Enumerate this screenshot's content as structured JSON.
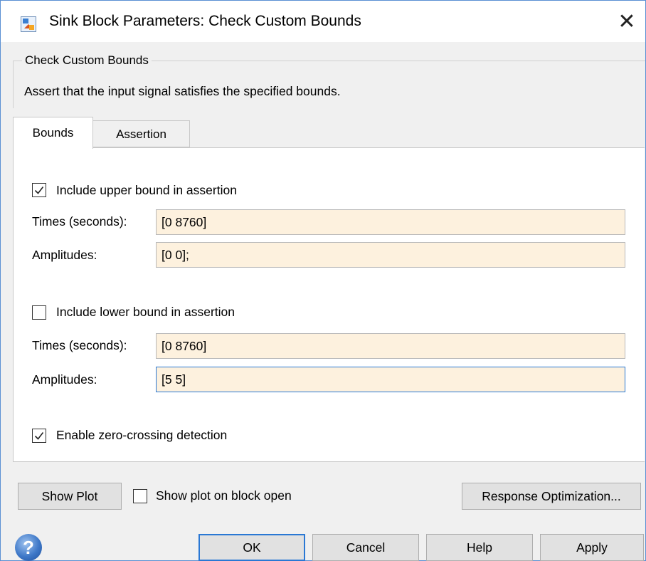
{
  "window": {
    "title": "Sink Block Parameters: Check Custom Bounds",
    "close_glyph": "✕"
  },
  "block": {
    "group_label": "Check Custom Bounds",
    "description": "Assert that the input signal satisfies the specified bounds."
  },
  "tabs": [
    {
      "label": "Bounds",
      "active": true
    },
    {
      "label": "Assertion",
      "active": false
    }
  ],
  "upper": {
    "checkbox_label": "Include upper bound in assertion",
    "checked": true,
    "times_label": "Times (seconds):",
    "times_value": "[0 8760]",
    "amplitudes_label": "Amplitudes:",
    "amplitudes_value": "[0 0];"
  },
  "lower": {
    "checkbox_label": "Include lower bound in assertion",
    "checked": false,
    "times_label": "Times (seconds):",
    "times_value": "[0 8760]",
    "amplitudes_label": "Amplitudes:",
    "amplitudes_value": "[5 5]"
  },
  "zero_crossing": {
    "label": "Enable zero-crossing detection",
    "checked": true
  },
  "bottom": {
    "show_plot_label": "Show Plot",
    "show_on_open_label": "Show plot on block open",
    "show_on_open_checked": false,
    "response_opt_label": "Response Optimization..."
  },
  "footer": {
    "help_glyph": "?",
    "ok_label": "OK",
    "cancel_label": "Cancel",
    "help_label": "Help",
    "apply_label": "Apply"
  },
  "colors": {
    "field_bg": "#fdf1de",
    "focus_border": "#2a78d4",
    "window_border": "#5a8fd3",
    "dialog_bg": "#f0f0f0"
  },
  "icons": {
    "app": "simulink-block-icon",
    "close": "close-icon",
    "help": "help-icon",
    "check": "checkmark-icon"
  }
}
